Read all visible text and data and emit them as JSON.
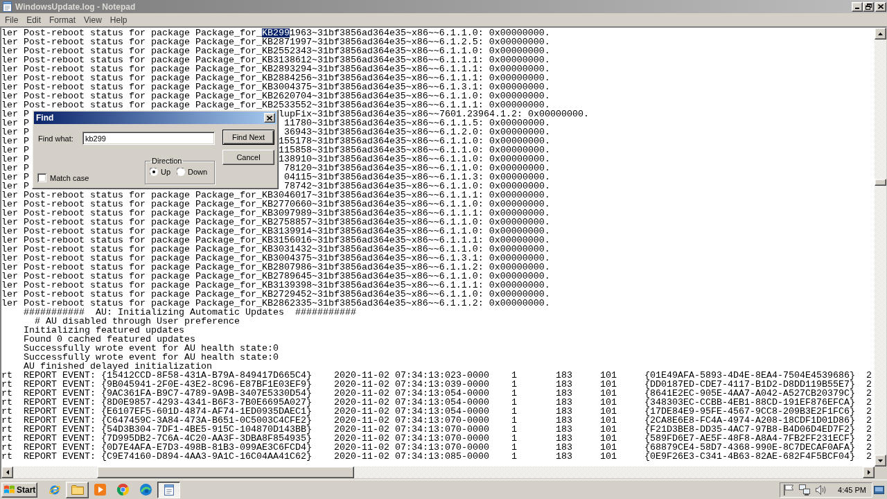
{
  "window": {
    "title": "WindowsUpdate.log - Notepad"
  },
  "menu": [
    "File",
    "Edit",
    "Format",
    "View",
    "Help"
  ],
  "log_lines": [
    {
      "kind": "segmented",
      "segments": [
        {
          "text": "ler Post-reboot status for package Package_for_",
          "selected": false
        },
        {
          "text": "KB299",
          "selected": true
        },
        {
          "text": "1963~31bf3856ad364e35~x86~~6.1.1.0: 0x00000000.",
          "selected": false
        }
      ]
    },
    {
      "kind": "plain",
      "text": "ler Post-reboot status for package Package_for_KB2871997~31bf3856ad364e35~x86~~6.1.2.5: 0x00000000."
    },
    {
      "kind": "plain",
      "text": "ler Post-reboot status for package Package_for_KB2552343~31bf3856ad364e35~x86~~6.1.1.0: 0x00000000."
    },
    {
      "kind": "plain",
      "text": "ler Post-reboot status for package Package_for_KB3138612~31bf3856ad364e35~x86~~6.1.1.1: 0x00000000."
    },
    {
      "kind": "plain",
      "text": "ler Post-reboot status for package Package_for_KB2893294~31bf3856ad364e35~x86~~6.1.1.1: 0x00000000."
    },
    {
      "kind": "plain",
      "text": "ler Post-reboot status for package Package_for_KB2884256~31bf3856ad364e35~x86~~6.1.1.1: 0x00000000."
    },
    {
      "kind": "plain",
      "text": "ler Post-reboot status for package Package_for_KB3004375~31bf3856ad364e35~x86~~6.1.3.1: 0x00000000."
    },
    {
      "kind": "plain",
      "text": "ler Post-reboot status for package Package_for_KB2620704~31bf3856ad364e35~x86~~6.1.1.0: 0x00000000."
    },
    {
      "kind": "plain",
      "text": "ler Post-reboot status for package Package_for_KB2533552~31bf3856ad364e35~x86~~6.1.1.1: 0x00000000."
    },
    {
      "kind": "covered",
      "left": "ler P",
      "right": "lupFix~31bf3856ad364e35~x86~~7601.23964.1.2: 0x00000000."
    },
    {
      "kind": "covered",
      "left": "ler P",
      "right": "11780~31bf3856ad364e35~x86~~6.1.1.5: 0x00000000."
    },
    {
      "kind": "covered",
      "left": "ler P",
      "right": "36943~31bf3856ad364e35~x86~~6.1.2.0: 0x00000000."
    },
    {
      "kind": "covered",
      "left": "ler P",
      "right": "155178~31bf3856ad364e35~x86~~6.1.1.0: 0x00000000."
    },
    {
      "kind": "covered",
      "left": "ler P",
      "right": "115858~31bf3856ad364e35~x86~~6.1.1.0: 0x00000000."
    },
    {
      "kind": "covered",
      "left": "ler P",
      "right": "138910~31bf3856ad364e35~x86~~6.1.1.0: 0x00000000."
    },
    {
      "kind": "covered",
      "left": "ler P",
      "right": "78120~31bf3856ad364e35~x86~~6.1.1.0: 0x00000000."
    },
    {
      "kind": "covered",
      "left": "ler P",
      "right": "04115~31bf3856ad364e35~x86~~6.1.1.3: 0x00000000."
    },
    {
      "kind": "covered",
      "left": "ler P",
      "right": "78742~31bf3856ad364e35~x86~~6.1.1.0: 0x00000000."
    },
    {
      "kind": "plain",
      "text": "ler Post-reboot status for package Package_for_KB3046017~31bf3856ad364e35~x86~~6.1.1.1: 0x00000000."
    },
    {
      "kind": "plain",
      "text": "ler Post-reboot status for package Package_for_KB2770660~31bf3856ad364e35~x86~~6.1.1.0: 0x00000000."
    },
    {
      "kind": "plain",
      "text": "ler Post-reboot status for package Package_for_KB3097989~31bf3856ad364e35~x86~~6.1.1.1: 0x00000000."
    },
    {
      "kind": "plain",
      "text": "ler Post-reboot status for package Package_for_KB2758857~31bf3856ad364e35~x86~~6.1.1.0: 0x00000000."
    },
    {
      "kind": "plain",
      "text": "ler Post-reboot status for package Package_for_KB3139914~31bf3856ad364e35~x86~~6.1.1.0: 0x00000000."
    },
    {
      "kind": "plain",
      "text": "ler Post-reboot status for package Package_for_KB3156016~31bf3856ad364e35~x86~~6.1.1.1: 0x00000000."
    },
    {
      "kind": "plain",
      "text": "ler Post-reboot status for package Package_for_KB3031432~31bf3856ad364e35~x86~~6.1.1.0: 0x00000000."
    },
    {
      "kind": "plain",
      "text": "ler Post-reboot status for package Package_for_KB3004375~31bf3856ad364e35~x86~~6.1.3.1: 0x00000000."
    },
    {
      "kind": "plain",
      "text": "ler Post-reboot status for package Package_for_KB2807986~31bf3856ad364e35~x86~~6.1.1.2: 0x00000000."
    },
    {
      "kind": "plain",
      "text": "ler Post-reboot status for package Package_for_KB2789645~31bf3856ad364e35~x86~~6.1.1.0: 0x00000000."
    },
    {
      "kind": "plain",
      "text": "ler Post-reboot status for package Package_for_KB3139398~31bf3856ad364e35~x86~~6.1.1.1: 0x00000000."
    },
    {
      "kind": "plain",
      "text": "ler Post-reboot status for package Package_for_KB2729452~31bf3856ad364e35~x86~~6.1.1.0: 0x00000000."
    },
    {
      "kind": "plain",
      "text": "ler Post-reboot status for package Package_for_KB2862335~31bf3856ad364e35~x86~~6.1.1.2: 0x00000000."
    },
    {
      "kind": "indented",
      "text": "###########  AU: Initializing Automatic Updates  ###########",
      "children": [
        {
          "text": "# AU disabled through User preference"
        }
      ]
    },
    {
      "kind": "indented",
      "text": "Initializing featured updates"
    },
    {
      "kind": "indented",
      "text": "Found 0 cached featured updates"
    },
    {
      "kind": "indented",
      "text": "Successfully wrote event for AU health state:0"
    },
    {
      "kind": "indented",
      "text": "Successfully wrote event for AU health state:0"
    },
    {
      "kind": "indented",
      "text": "AU finished delayed initialization"
    },
    {
      "kind": "event",
      "cells": [
        "rt",
        "REPORT EVENT:",
        "{15412CCD-8F58-431A-B79A-849417D665C4}",
        "2020-11-02 07:34:13:023-0000",
        "1",
        "183",
        "101",
        "{01E49AFA-5893-4D4E-8EA4-7504E4539686}",
        "2"
      ]
    },
    {
      "kind": "event",
      "cells": [
        "rt",
        "REPORT EVENT:",
        "{9B045941-2F0E-43E2-8C96-E87BF1E03EF9}",
        "2020-11-02 07:34:13:039-0000",
        "1",
        "183",
        "101",
        "{DD0187ED-CDE7-4117-B1D2-D8DD119B55E7}",
        "2"
      ]
    },
    {
      "kind": "event",
      "cells": [
        "rt",
        "REPORT EVENT:",
        "{9AC361FA-B9C7-4789-9A9B-3407E5330D54}",
        "2020-11-02 07:34:13:054-0000",
        "1",
        "183",
        "101",
        "{8641E2EC-905E-4AA7-A042-A527CB20379C}",
        "2"
      ]
    },
    {
      "kind": "event",
      "cells": [
        "rt",
        "REPORT EVENT:",
        "{8D0E9857-4293-4341-B6F3-7B0E6695A027}",
        "2020-11-02 07:34:13:054-0000",
        "1",
        "183",
        "101",
        "{348303EC-CCBB-4EB1-88CD-191EF876EFCA}",
        "2"
      ]
    },
    {
      "kind": "event",
      "cells": [
        "rt",
        "REPORT EVENT:",
        "{E6107EF5-601D-4874-AF74-1ED0935DAEC1}",
        "2020-11-02 07:34:13:054-0000",
        "1",
        "183",
        "101",
        "{17DE84E9-95FE-4567-9CC8-209B3E2F1FC6}",
        "2"
      ]
    },
    {
      "kind": "event",
      "cells": [
        "rt",
        "REPORT EVENT:",
        "{C647459C-3A84-473A-B651-0C5003C4CFE2}",
        "2020-11-02 07:34:13:070-0000",
        "1",
        "183",
        "101",
        "{2CA8E6E8-FC4A-4974-A208-18CDF1D01D86}",
        "2"
      ]
    },
    {
      "kind": "event",
      "cells": [
        "rt",
        "REPORT EVENT:",
        "{54D3B304-7DF1-4BE5-915C-104870D143BB}",
        "2020-11-02 07:34:13:070-0000",
        "1",
        "183",
        "101",
        "{F21D3BE8-DD35-4AC7-97B8-B4D06D4ED7F2}",
        "2"
      ]
    },
    {
      "kind": "event",
      "cells": [
        "rt",
        "REPORT EVENT:",
        "{7D995DB2-7C6A-4C20-AA3F-3DBA8F854935}",
        "2020-11-02 07:34:13:070-0000",
        "1",
        "183",
        "101",
        "{589FD6E7-AE5F-48F8-A8A4-7FB2FF231ECF}",
        "2"
      ]
    },
    {
      "kind": "event",
      "cells": [
        "rt",
        "REPORT EVENT:",
        "{0D7E4AFA-E7D3-498B-81B3-099AE3C6FCD4}",
        "2020-11-02 07:34:13:070-0000",
        "1",
        "183",
        "101",
        "{68879CE4-58D7-4368-990E-8C7DECAF0AFA}",
        "2"
      ]
    },
    {
      "kind": "event",
      "cells": [
        "rt",
        "REPORT EVENT:",
        "{C9E74160-D894-4AA3-9A1C-16C04AA41C62}",
        "2020-11-02 07:34:13:085-0000",
        "1",
        "183",
        "101",
        "{0E9F26E3-C341-4B63-82AE-682F4F5BCF04}",
        "2"
      ]
    }
  ],
  "find_dialog": {
    "title": "Find",
    "find_what": {
      "label": "Find what:",
      "value": "kb299"
    },
    "buttons": [
      {
        "label": "Find Next",
        "default": true
      },
      {
        "label": "Cancel",
        "default": false
      }
    ],
    "match_case": {
      "label": "Match case",
      "checked": false
    },
    "direction": {
      "label": "Direction",
      "options": [
        {
          "label": "Up",
          "selected": true
        },
        {
          "label": "Down",
          "selected": false
        }
      ]
    }
  },
  "taskbar": {
    "start": "Start",
    "buttons": [
      {
        "open": false,
        "active": false
      },
      {
        "open": true,
        "active": false
      },
      {
        "open": false,
        "active": false
      },
      {
        "open": false,
        "active": false
      },
      {
        "open": false,
        "active": false
      },
      {
        "open": true,
        "active": true
      }
    ],
    "clock": "4:45 PM"
  }
}
